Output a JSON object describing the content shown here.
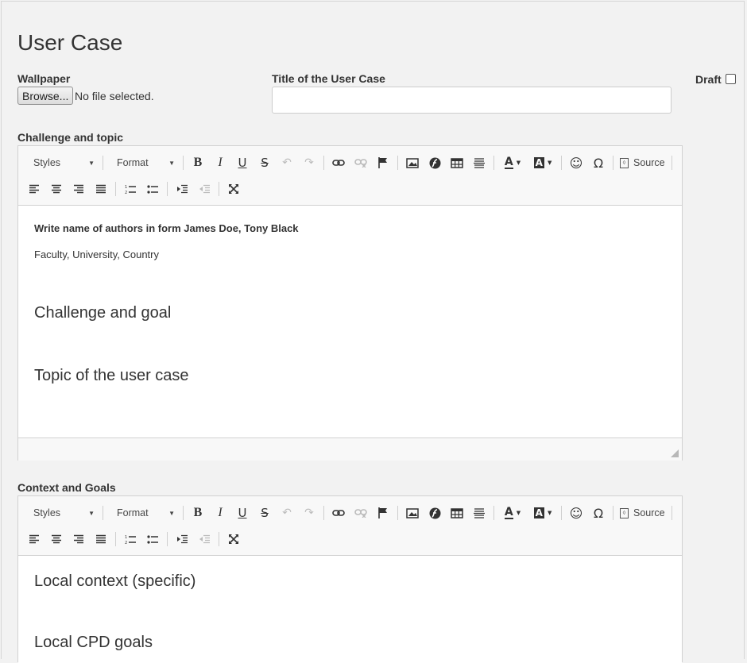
{
  "page": {
    "title": "User Case"
  },
  "form": {
    "wallpaper_label": "Wallpaper",
    "browse_label": "Browse...",
    "file_status": "No file selected.",
    "title_label": "Title of the User Case",
    "title_value": "",
    "draft_label": "Draft"
  },
  "toolbar": {
    "styles": "Styles",
    "format": "Format",
    "source": "Source",
    "icons_row1": [
      "bold-icon",
      "italic-icon",
      "underline-icon",
      "strikethrough-icon",
      "undo-icon",
      "redo-icon",
      "link-icon",
      "unlink-icon",
      "anchor-flag-icon",
      "image-icon",
      "flash-icon",
      "table-icon",
      "horizontal-line-icon",
      "text-color-icon",
      "background-color-icon",
      "smiley-icon",
      "special-char-omega-icon",
      "source-icon"
    ],
    "icons_row2": [
      "align-left-icon",
      "align-center-icon",
      "align-right-icon",
      "align-justify-icon",
      "numbered-list-icon",
      "bulleted-list-icon",
      "indent-icon",
      "outdent-icon",
      "maximize-icon"
    ]
  },
  "editor1": {
    "label": "Challenge and topic",
    "authors": "Write name of authors in form James Doe, Tony Black",
    "affiliation": "Faculty, University, Country",
    "heading1": "Challenge and goal",
    "heading2": "Topic of the user case"
  },
  "editor2": {
    "label": "Context and Goals",
    "heading1": "Local context (specific)",
    "heading2": "Local CPD goals"
  }
}
